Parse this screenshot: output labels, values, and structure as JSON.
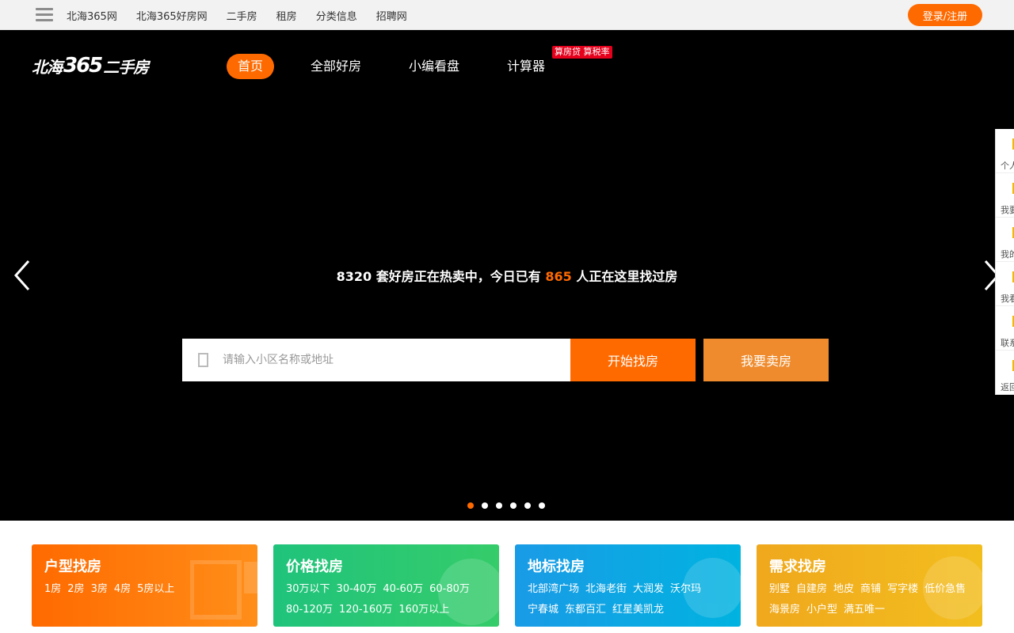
{
  "topbar": {
    "links": [
      "北海365网",
      "北海365好房网",
      "二手房",
      "租房",
      "分类信息",
      "招聘网"
    ],
    "login_label": "登录/注册"
  },
  "logo": {
    "part_a": "北海",
    "number": "365",
    "part_b": "二手房"
  },
  "nav": {
    "items": [
      "首页",
      "全部好房",
      "小编看盘",
      "计算器"
    ],
    "active_index": 0,
    "badge": "算房贷 算税率"
  },
  "hero": {
    "count_listings": "8320",
    "text_1": " 套好房正在热卖中，今日已有 ",
    "count_visitors": "865",
    "text_2": " 人正在这里找过房"
  },
  "search": {
    "placeholder": "请输入小区名称或地址",
    "value": "",
    "search_label": "开始找房",
    "sell_label": "我要卖房"
  },
  "carousel": {
    "slide_count": 6,
    "active_index": 0
  },
  "sidebar": {
    "items": [
      "个人",
      "我要",
      "我的",
      "我看",
      "联系",
      "返回"
    ],
    "icon_color": "#f2b600"
  },
  "cards": [
    {
      "title": "户型找房",
      "links": [
        "1房",
        "2房",
        "3房",
        "4房",
        "5房以上"
      ]
    },
    {
      "title": "价格找房",
      "links": [
        "30万以下",
        "30-40万",
        "40-60万",
        "60-80万",
        "80-120万",
        "120-160万",
        "160万以上"
      ]
    },
    {
      "title": "地标找房",
      "links": [
        "北部湾广场",
        "北海老街",
        "大润发",
        "沃尔玛",
        "宁春城",
        "东都百汇",
        "红星美凯龙"
      ]
    },
    {
      "title": "需求找房",
      "links": [
        "别墅",
        "自建房",
        "地皮",
        "商铺",
        "写字楼",
        "低价急售",
        "海景房",
        "小户型",
        "满五唯一"
      ]
    }
  ],
  "colors": {
    "accent": "#ff6a00",
    "sell": "#ef8b2c",
    "badge": "#e5001c"
  }
}
